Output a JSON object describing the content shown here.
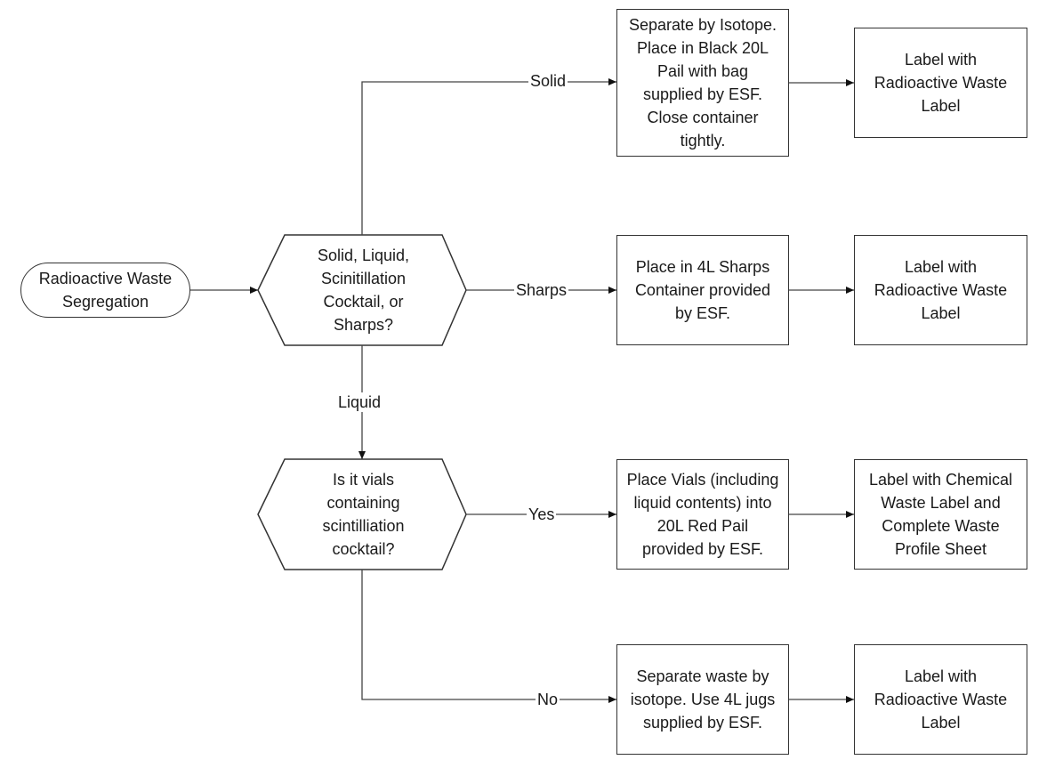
{
  "diagram": {
    "start": {
      "label": "Radioactive Waste\nSegregation"
    },
    "decision1": {
      "label": "Solid, Liquid,\nScinitillation\nCocktail, or\nSharps?"
    },
    "decision2": {
      "label": "Is it vials\ncontaining\nscintilliation\ncocktail?"
    },
    "edges": {
      "solid": "Solid",
      "sharps": "Sharps",
      "liquid": "Liquid",
      "yes": "Yes",
      "no": "No"
    },
    "steps": {
      "solid_action": "Separate by Isotope.\nPlace in Black 20L\nPail with bag\nsupplied by ESF.\nClose container\ntightly.",
      "solid_label": "Label with\nRadioactive Waste\nLabel",
      "sharps_action": "Place in 4L Sharps\nContainer provided\nby ESF.",
      "sharps_label": "Label with\nRadioactive Waste\nLabel",
      "yes_action": "Place Vials (including\nliquid contents) into\n20L Red Pail\nprovided by ESF.",
      "yes_label": "Label with Chemical\nWaste Label and\nComplete Waste\nProfile Sheet",
      "no_action": "Separate waste by\nisotope. Use 4L jugs\nsupplied by ESF.",
      "no_label": "Label with\nRadioactive Waste\nLabel"
    }
  }
}
